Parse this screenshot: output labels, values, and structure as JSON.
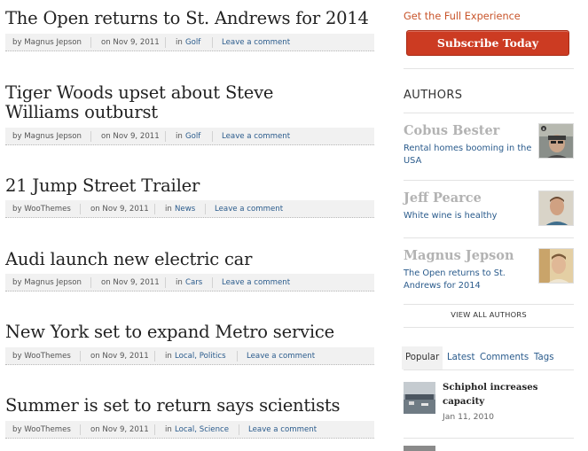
{
  "posts": [
    {
      "title": "The Open returns to St. Andrews for 2014",
      "author": "by Magnus Jepson",
      "date": "on Nov 9, 2011",
      "category_prefix": "in",
      "category": "Golf",
      "comments": "Leave a comment"
    },
    {
      "title": "Tiger Woods upset about Steve Williams outburst",
      "author": "by Magnus Jepson",
      "date": "on Nov 9, 2011",
      "category_prefix": "in",
      "category": "Golf",
      "comments": "Leave a comment"
    },
    {
      "title": "21 Jump Street Trailer",
      "author": "by WooThemes",
      "date": "on Nov 9, 2011",
      "category_prefix": "in",
      "category": "News",
      "comments": "Leave a comment"
    },
    {
      "title": "Audi launch new electric car",
      "author": "by Magnus Jepson",
      "date": "on Nov 9, 2011",
      "category_prefix": "in",
      "category": "Cars",
      "comments": "Leave a comment"
    },
    {
      "title": "New York set to expand Metro service",
      "author": "by WooThemes",
      "date": "on Nov 9, 2011",
      "category_prefix": "in",
      "category": "Local, Politics",
      "comments": "Leave a comment"
    },
    {
      "title": "Summer is set to return says scientists",
      "author": "by WooThemes",
      "date": "on Nov 9, 2011",
      "category_prefix": "in",
      "category": "Local, Science",
      "comments": "Leave a comment"
    }
  ],
  "sidebar": {
    "promo_title": "Get the Full Experience",
    "subscribe_label": "Subscribe Today",
    "authors_heading": "AUTHORS",
    "authors": [
      {
        "name": "Cobus Bester",
        "latest_post": "Rental homes booming in the USA"
      },
      {
        "name": "Jeff Pearce",
        "latest_post": "White wine is healthy"
      },
      {
        "name": "Magnus Jepson",
        "latest_post": "The Open returns to St. Andrews for 2014"
      }
    ],
    "view_all_label": "VIEW ALL AUTHORS",
    "tabs": [
      "Popular",
      "Latest",
      "Comments",
      "Tags"
    ],
    "popular": [
      {
        "title": "Schiphol increases capacity",
        "date": "Jan 11, 2010"
      }
    ]
  },
  "colors": {
    "link": "#2a5b8c",
    "accent": "#c8542a",
    "subscribe_button": "#cc3b22",
    "meta_bar": "#f1f1f1",
    "author_name": "#b3b3b3"
  }
}
